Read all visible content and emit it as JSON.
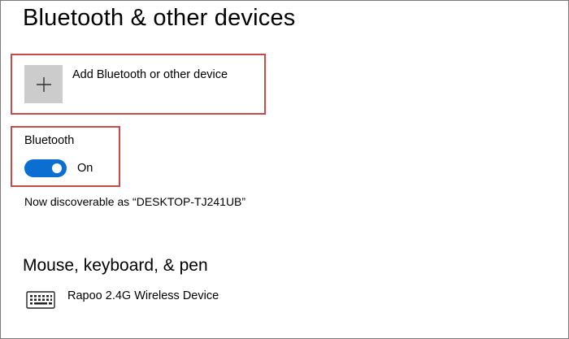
{
  "page": {
    "title": "Bluetooth & other devices"
  },
  "add_device": {
    "label": "Add Bluetooth or other device",
    "icon": "plus-icon"
  },
  "bluetooth": {
    "label": "Bluetooth",
    "toggle_on": true,
    "toggle_state_label": "On",
    "accent_color": "#0a6fd0",
    "discoverable_text": "Now discoverable as “DESKTOP-TJ241UB”"
  },
  "mouse_section": {
    "title": "Mouse, keyboard, & pen",
    "devices": [
      {
        "name": "Rapoo 2.4G Wireless Device",
        "icon": "keyboard-icon"
      }
    ]
  },
  "highlight_color": "#c94a4a"
}
